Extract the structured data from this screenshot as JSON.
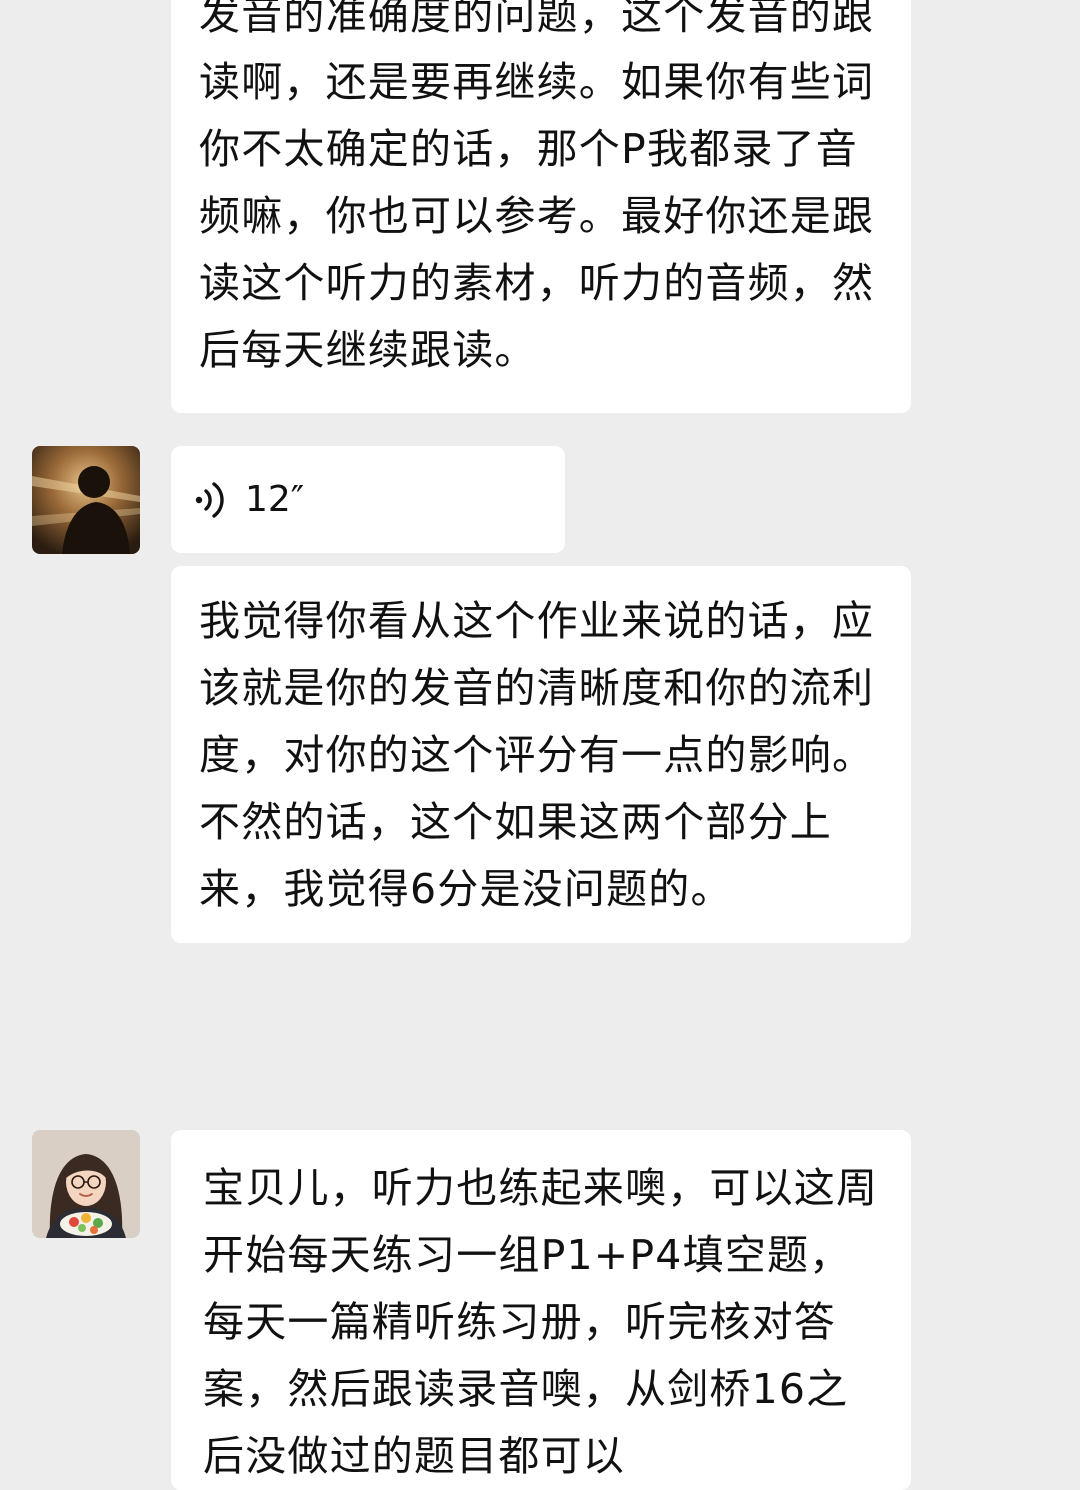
{
  "messages": {
    "m1": {
      "text": "发音的准确度的问题，这个发音的跟读啊，还是要再继续。如果你有些词你不太确定的话，那个P我都录了音频嘛，你也可以参考。最好你还是跟读这个听力的素材，听力的音频，然后每天继续跟读。"
    },
    "m2": {
      "duration": "12″",
      "icon": "voice-wave-icon"
    },
    "m3": {
      "text": "我觉得你看从这个作业来说的话，应该就是你的发音的清晰度和你的流利度，对你的这个评分有一点的影响。不然的话，这个如果这两个部分上来，我觉得6分是没问题的。"
    },
    "m4": {
      "text": "宝贝儿，听力也练起来噢，可以这周开始每天练习一组P1+P4填空题，每天一篇精听练习册，听完核对答案，然后跟读录音噢，从剑桥16之后没做过的题目都可以"
    }
  },
  "colors": {
    "background": "#ededed",
    "bubble": "#ffffff",
    "text": "#111111"
  }
}
